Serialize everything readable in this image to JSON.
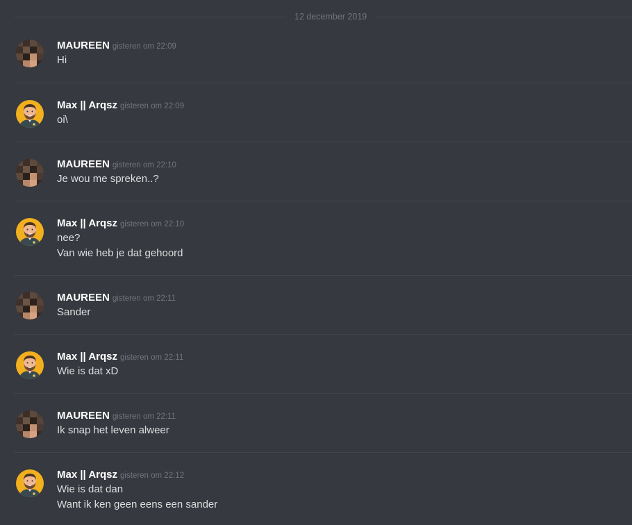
{
  "date_divider": "12 december 2019",
  "colors": {
    "background": "#36393f",
    "divider": "#42454a",
    "username": "#ffffff",
    "timestamp": "#72767d",
    "message_text": "#dcddde",
    "max_avatar_bg": "#f2b01e"
  },
  "messages": [
    {
      "author": "MAUREEN",
      "timestamp": "gisteren om 22:09",
      "avatar": "pixelated-avatar",
      "lines": [
        "Hi"
      ]
    },
    {
      "author": "Max || Arqsz",
      "timestamp": "gisteren om 22:09",
      "avatar": "cartoon-man-avatar",
      "lines": [
        "oi\\"
      ]
    },
    {
      "author": "MAUREEN",
      "timestamp": "gisteren om 22:10",
      "avatar": "pixelated-avatar",
      "lines": [
        "Je wou me spreken..?"
      ]
    },
    {
      "author": "Max || Arqsz",
      "timestamp": "gisteren om 22:10",
      "avatar": "cartoon-man-avatar",
      "lines": [
        "nee?",
        "Van wie heb je dat gehoord"
      ]
    },
    {
      "author": "MAUREEN",
      "timestamp": "gisteren om 22:11",
      "avatar": "pixelated-avatar",
      "lines": [
        "Sander"
      ]
    },
    {
      "author": "Max || Arqsz",
      "timestamp": "gisteren om 22:11",
      "avatar": "cartoon-man-avatar",
      "lines": [
        "Wie is dat xD"
      ]
    },
    {
      "author": "MAUREEN",
      "timestamp": "gisteren om 22:11",
      "avatar": "pixelated-avatar",
      "lines": [
        "Ik snap het leven alweer"
      ]
    },
    {
      "author": "Max || Arqsz",
      "timestamp": "gisteren om 22:12",
      "avatar": "cartoon-man-avatar",
      "lines": [
        "Wie is dat dan",
        "Want ik ken geen eens een sander"
      ]
    }
  ]
}
